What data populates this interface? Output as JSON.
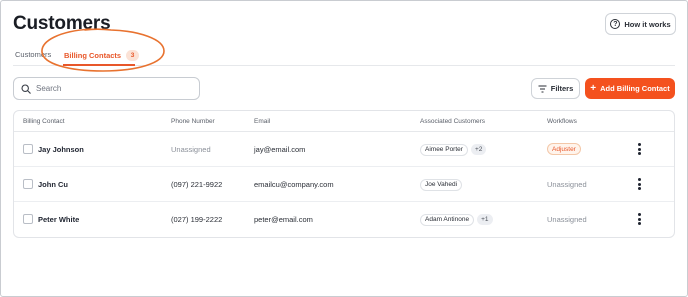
{
  "page": {
    "title": "Customers"
  },
  "header": {
    "how_it_works_label": "How it works",
    "how_it_works_icon": "question-circle-icon"
  },
  "tabs": [
    {
      "label": "Customers",
      "active": false
    },
    {
      "label": "Billing Contacts",
      "active": true,
      "count": "3"
    }
  ],
  "toolbar": {
    "search_placeholder": "Search",
    "filters_label": "Filters",
    "add_button_label": "Add Billing Contact",
    "add_button_icon": "+"
  },
  "table": {
    "columns": [
      "Billing Contact",
      "Phone Number",
      "Email",
      "Associated Customers",
      "Workflows"
    ],
    "rows": [
      {
        "name": "Jay Johnson",
        "phone": "Unassigned",
        "email": "jay@email.com",
        "customer": "Aimee Porter",
        "more": "+2",
        "workflow": "Adjuster"
      },
      {
        "name": "John Cu",
        "phone": "(097) 221-9922",
        "email": "emailcu@company.com",
        "customer": "Joe Vahedi",
        "more": "",
        "workflow": "Unassigned"
      },
      {
        "name": "Peter White",
        "phone": "(027) 199-2222",
        "email": "peter@email.com",
        "customer": "Adam Antinone",
        "more": "+1",
        "workflow": "Unassigned"
      }
    ]
  },
  "colors": {
    "accent": "#f4511e",
    "accent_text": "#e8572a",
    "annotation": "#e8722f"
  }
}
